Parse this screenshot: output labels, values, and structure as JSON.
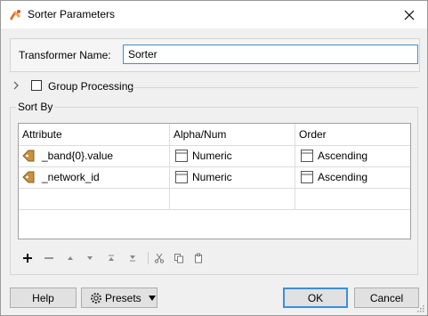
{
  "window": {
    "title": "Sorter Parameters"
  },
  "transformer": {
    "label": "Transformer Name:",
    "value": "Sorter"
  },
  "group_processing": {
    "label": "Group Processing",
    "checked": false
  },
  "sort_by": {
    "label": "Sort By",
    "columns": [
      "Attribute",
      "Alpha/Num",
      "Order"
    ],
    "rows": [
      {
        "attribute": "_band{0}.value",
        "alpha_num": "Numeric",
        "order": "Ascending"
      },
      {
        "attribute": "_network_id",
        "alpha_num": "Numeric",
        "order": "Ascending"
      }
    ]
  },
  "toolbar": {
    "icons": [
      "add-icon",
      "remove-icon",
      "move-up-icon",
      "move-down-icon",
      "move-top-icon",
      "move-bottom-icon",
      "cut-icon",
      "copy-icon",
      "paste-icon"
    ]
  },
  "buttons": {
    "help": "Help",
    "presets": "Presets",
    "ok": "OK",
    "cancel": "Cancel"
  },
  "colors": {
    "accent": "#3c8fd8",
    "attribute_icon": "#c8923e"
  }
}
